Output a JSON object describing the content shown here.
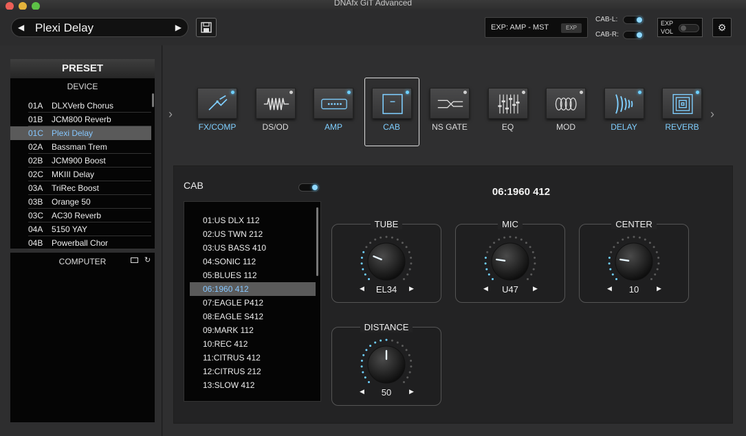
{
  "window": {
    "title": "DNAfx GiT Advanced"
  },
  "toolbar": {
    "preset_name": "Plexi Delay",
    "prev_arrow": "◀",
    "next_arrow": "▶",
    "exp_text": "EXP: AMP - MST",
    "exp_badge": "EXP",
    "cab_l_label": "CAB-L:",
    "cab_r_label": "CAB-R:",
    "exp_vol_line1": "EXP",
    "exp_vol_line2": "VOL",
    "settings_glyph": "⚙"
  },
  "sidebar": {
    "preset_header": "PRESET",
    "device_label": "DEVICE",
    "computer_label": "COMPUTER",
    "presets": [
      {
        "code": "01A",
        "name": "DLXVerb Chorus",
        "selected": false
      },
      {
        "code": "01B",
        "name": "JCM800 Reverb",
        "selected": false
      },
      {
        "code": "01C",
        "name": "Plexi Delay",
        "selected": true
      },
      {
        "code": "02A",
        "name": "Bassman Trem",
        "selected": false
      },
      {
        "code": "02B",
        "name": "JCM900 Boost",
        "selected": false
      },
      {
        "code": "02C",
        "name": "MKIII Delay",
        "selected": false
      },
      {
        "code": "03A",
        "name": "TriRec Boost",
        "selected": false
      },
      {
        "code": "03B",
        "name": "Orange 50",
        "selected": false
      },
      {
        "code": "03C",
        "name": "AC30 Reverb",
        "selected": false
      },
      {
        "code": "04A",
        "name": "5150 YAY",
        "selected": false
      },
      {
        "code": "04B",
        "name": "Powerball Chor",
        "selected": false
      }
    ]
  },
  "chain": [
    {
      "id": "fxcomp",
      "label": "FX/COMP",
      "active": true,
      "icon": "fx-comp-icon"
    },
    {
      "id": "dsod",
      "label": "DS/OD",
      "active": false,
      "icon": "distortion-icon"
    },
    {
      "id": "amp",
      "label": "AMP",
      "active": true,
      "icon": "amp-icon"
    },
    {
      "id": "cab",
      "label": "CAB",
      "active": true,
      "icon": "cab-icon",
      "selected": true
    },
    {
      "id": "nsgate",
      "label": "NS GATE",
      "active": false,
      "icon": "gate-icon"
    },
    {
      "id": "eq",
      "label": "EQ",
      "active": false,
      "icon": "eq-icon"
    },
    {
      "id": "mod",
      "label": "MOD",
      "active": false,
      "icon": "mod-icon"
    },
    {
      "id": "delay",
      "label": "DELAY",
      "active": true,
      "icon": "delay-icon"
    },
    {
      "id": "reverb",
      "label": "REVERB",
      "active": true,
      "icon": "reverb-icon"
    }
  ],
  "cab_panel": {
    "title": "CAB",
    "current_value": "06:1960 412",
    "cabs": [
      {
        "name": "01:US DLX 112",
        "selected": false
      },
      {
        "name": "02:US TWN 212",
        "selected": false
      },
      {
        "name": "03:US BASS 410",
        "selected": false
      },
      {
        "name": "04:SONIC 112",
        "selected": false
      },
      {
        "name": "05:BLUES 112",
        "selected": false
      },
      {
        "name": "06:1960 412",
        "selected": true
      },
      {
        "name": "07:EAGLE P412",
        "selected": false
      },
      {
        "name": "08:EAGLE S412",
        "selected": false
      },
      {
        "name": "09:MARK 112",
        "selected": false
      },
      {
        "name": "10:REC 412",
        "selected": false
      },
      {
        "name": "11:CITRUS 412",
        "selected": false
      },
      {
        "name": "12:CITRUS 212",
        "selected": false
      },
      {
        "name": "13:SLOW 412",
        "selected": false
      }
    ],
    "knobs": {
      "tube": {
        "label": "TUBE",
        "value": "EL34",
        "level": 0.25
      },
      "mic": {
        "label": "MIC",
        "value": "U47",
        "level": 0.2
      },
      "center": {
        "label": "CENTER",
        "value": "10",
        "level": 0.2
      },
      "distance": {
        "label": "DISTANCE",
        "value": "50",
        "level": 0.5
      }
    }
  },
  "colors": {
    "accent": "#6fd0ff",
    "selected_text": "#86c7ff",
    "panel_bg": "#232324"
  }
}
